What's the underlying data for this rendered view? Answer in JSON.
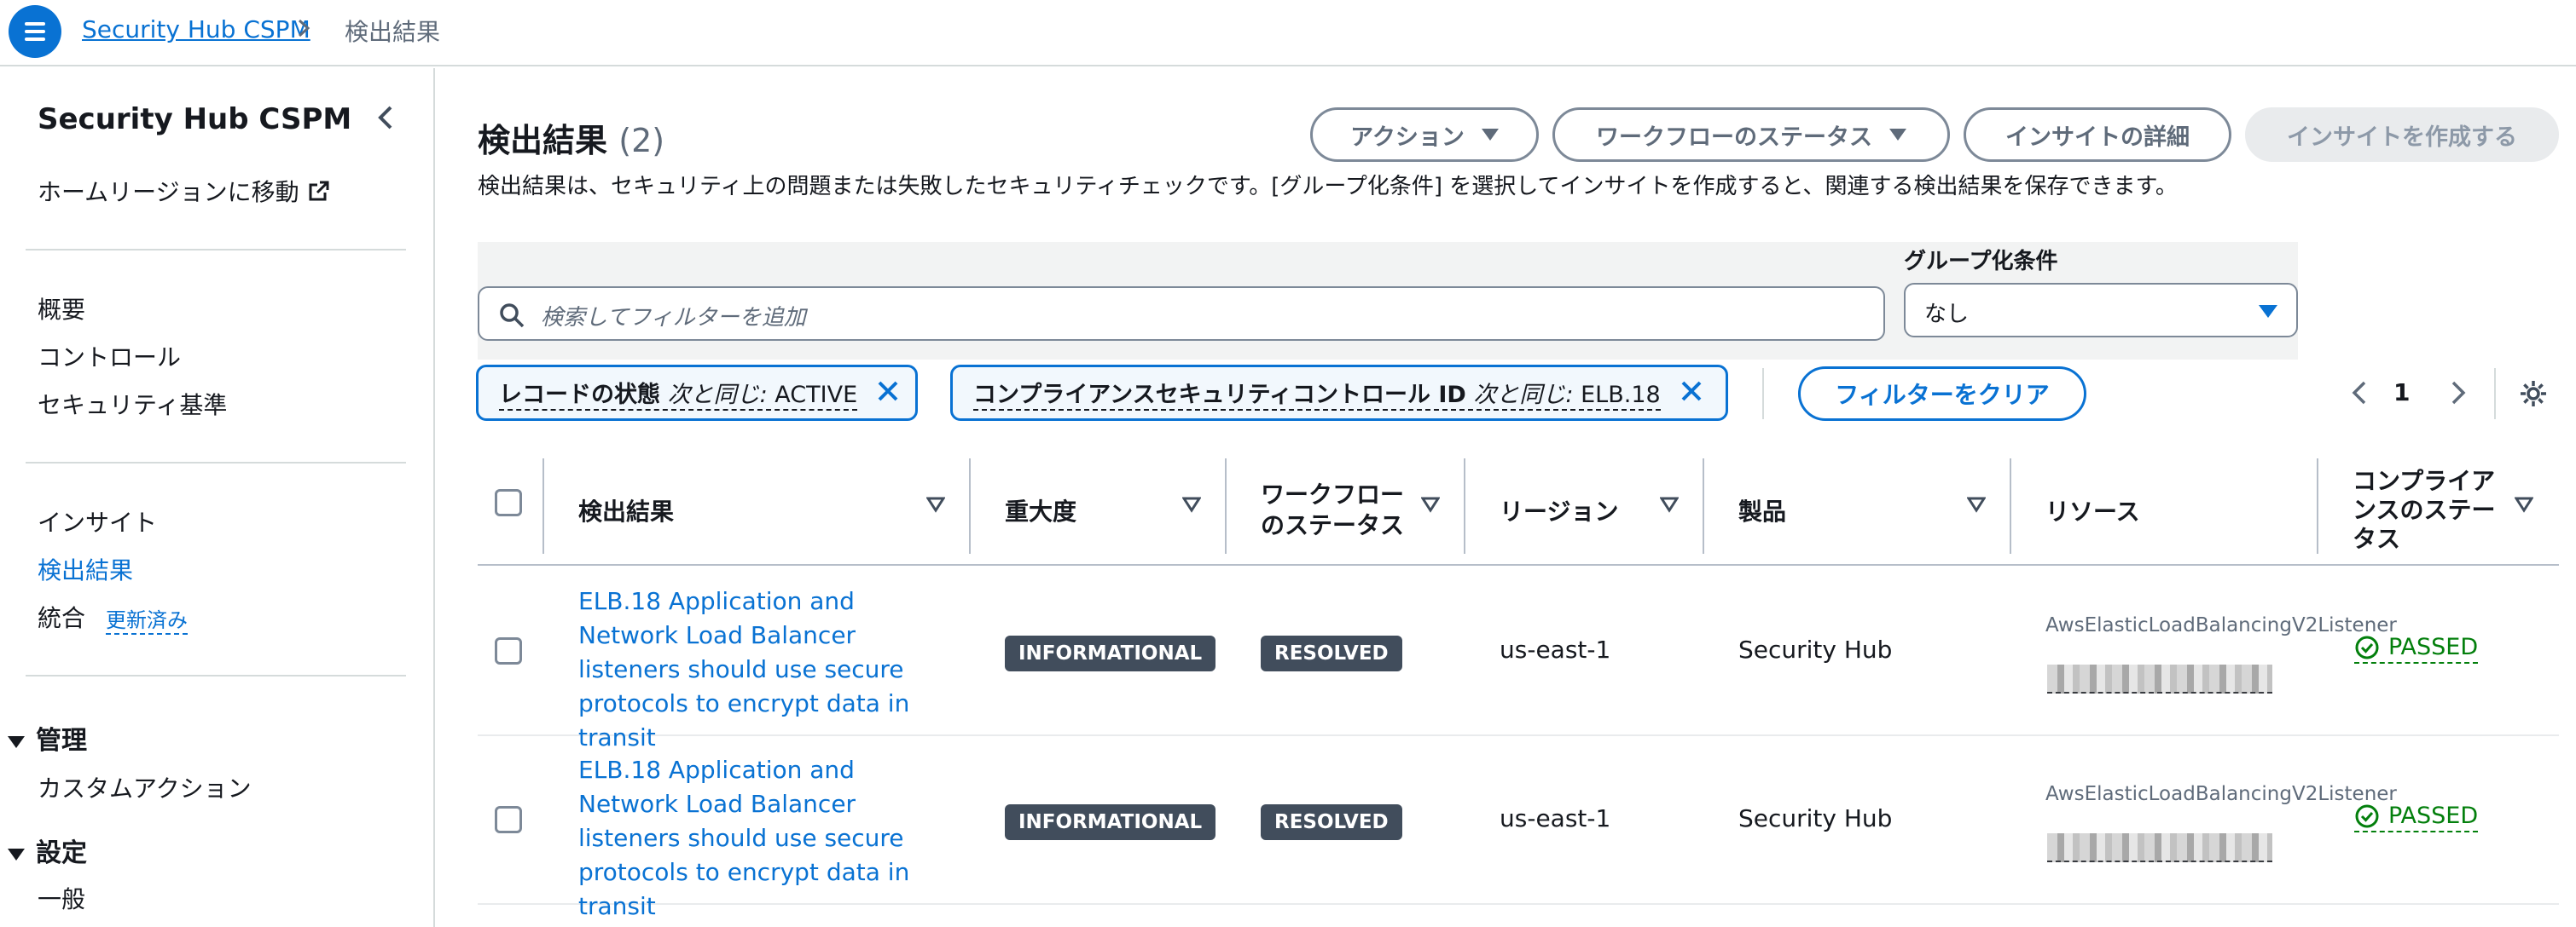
{
  "breadcrumb": {
    "service": "Security Hub CSPM",
    "current": "検出結果"
  },
  "sidebar": {
    "title": "Security Hub CSPM",
    "home_region": "ホームリージョンに移動",
    "items": [
      "概要",
      "コントロール",
      "セキュリティ基準"
    ],
    "items2": [
      "インサイト",
      "検出結果"
    ],
    "integration": "統合",
    "updated": "更新済み",
    "section_admin": "管理",
    "custom_actions": "カスタムアクション",
    "section_settings": "設定",
    "general": "一般"
  },
  "header": {
    "title": "検出結果",
    "count": "(2)",
    "description": "検出結果は、セキュリティ上の問題または失敗したセキュリティチェックです。[グループ化条件] を選択してインサイトを作成すると、関連する検出結果を保存できます。",
    "actions": "アクション",
    "workflow_status": "ワークフローのステータス",
    "insight_details": "インサイトの詳細",
    "create_insight": "インサイトを作成する"
  },
  "filters": {
    "search_placeholder": "検索してフィルターを追加",
    "group_by_label": "グループ化条件",
    "group_by_value": "なし",
    "tokens": [
      {
        "key": "レコードの状態",
        "op": "次と同じ:",
        "value": "ACTIVE"
      },
      {
        "key": "コンプライアンスセキュリティコントロール ID",
        "op": "次と同じ:",
        "value": "ELB.18"
      }
    ],
    "clear": "フィルターをクリア",
    "page": "1"
  },
  "table": {
    "columns": [
      "検出結果",
      "重大度",
      "ワークフロー\nのステータス",
      "リージョン",
      "製品",
      "リソース",
      "コンプライア\nンスのステー\nタス"
    ],
    "rows": [
      {
        "finding": "ELB.18 Application and Network Load Balancer listeners should use secure protocols to encrypt data in transit",
        "severity": "INFORMATIONAL",
        "workflow": "RESOLVED",
        "region": "us-east-1",
        "product": "Security Hub",
        "resource_type": "AwsElasticLoadBalancingV2Listener",
        "compliance": "PASSED"
      },
      {
        "finding": "ELB.18 Application and Network Load Balancer listeners should use secure protocols to encrypt data in transit",
        "severity": "INFORMATIONAL",
        "workflow": "RESOLVED",
        "region": "us-east-1",
        "product": "Security Hub",
        "resource_type": "AwsElasticLoadBalancingV2Listener",
        "compliance": "PASSED"
      }
    ]
  },
  "colors": {
    "primary": "#0972d3",
    "badge": "#414d5c",
    "passed": "#037f0c"
  }
}
